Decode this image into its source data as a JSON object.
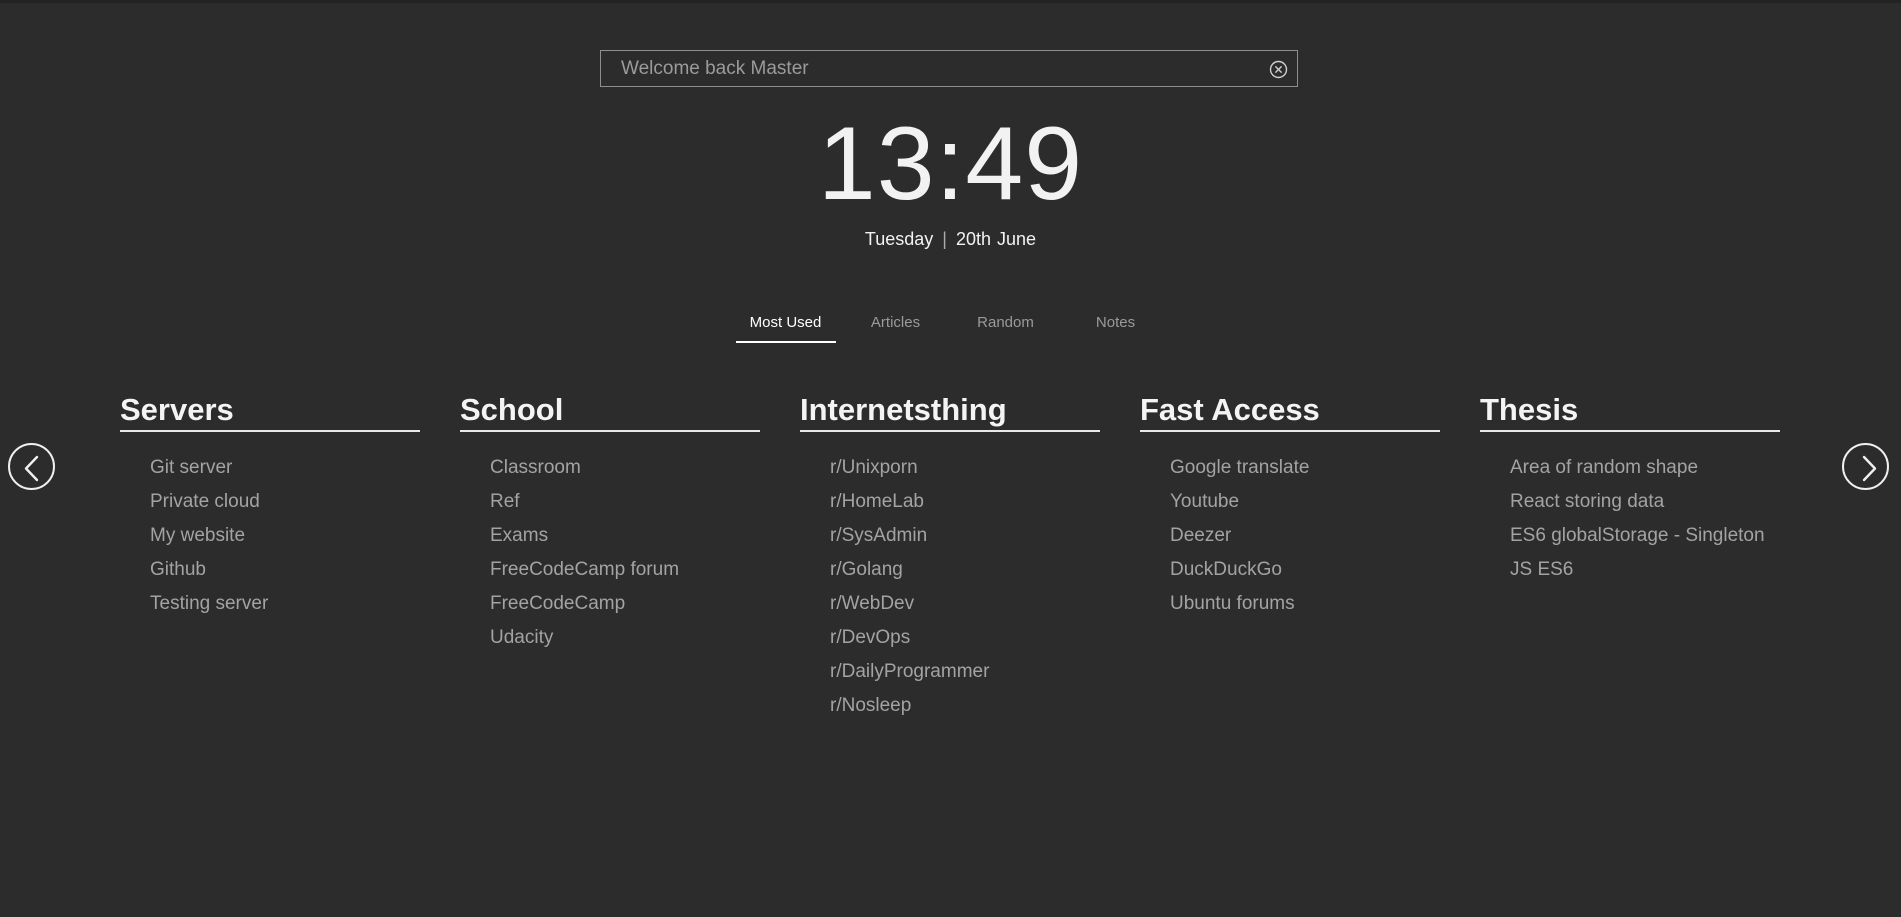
{
  "search": {
    "placeholder": "Welcome back Master",
    "value": ""
  },
  "clock": {
    "time": "13:49"
  },
  "date": {
    "weekday": "Tuesday",
    "separator": "|",
    "day": "20th",
    "month": "June"
  },
  "tabs": [
    {
      "label": "Most Used",
      "active": true
    },
    {
      "label": "Articles",
      "active": false
    },
    {
      "label": "Random",
      "active": false
    },
    {
      "label": "Notes",
      "active": false
    }
  ],
  "columns": [
    {
      "title": "Servers",
      "links": [
        "Git server",
        "Private cloud",
        "My website",
        "Github",
        "Testing server"
      ]
    },
    {
      "title": "School",
      "links": [
        "Classroom",
        "Ref",
        "Exams",
        "FreeCodeCamp forum",
        "FreeCodeCamp",
        "Udacity"
      ]
    },
    {
      "title": "Internetsthing",
      "links": [
        "r/Unixporn",
        "r/HomeLab",
        "r/SysAdmin",
        "r/Golang",
        "r/WebDev",
        "r/DevOps",
        "r/DailyProgrammer",
        "r/Nosleep"
      ]
    },
    {
      "title": "Fast Access",
      "links": [
        "Google translate",
        "Youtube",
        "Deezer",
        "DuckDuckGo",
        "Ubuntu forums"
      ]
    },
    {
      "title": "Thesis",
      "links": [
        "Area of random shape",
        "React storing data",
        "ES6 globalStorage - Singleton",
        "JS ES6"
      ]
    }
  ],
  "icons": {
    "clear": "clear-circle-x-icon",
    "prev": "chevron-left-icon",
    "next": "chevron-right-icon"
  },
  "colors": {
    "background": "#2c2c2c",
    "text": "#f2f2f2",
    "muted": "#a3a3a3"
  }
}
